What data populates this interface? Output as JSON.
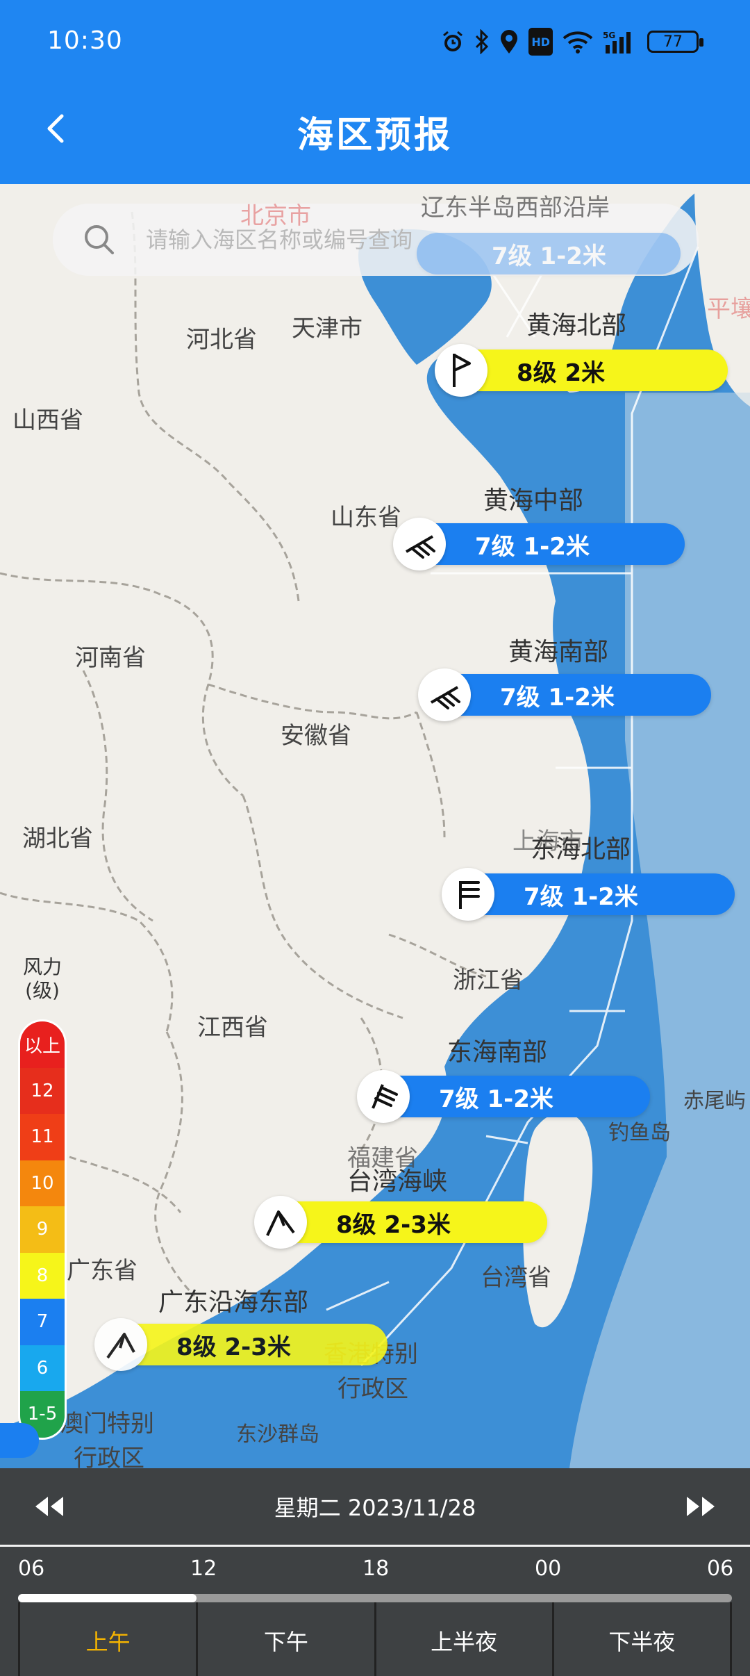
{
  "status_bar": {
    "time": "10:30",
    "battery": "77",
    "network": "5G",
    "hd": "HD"
  },
  "header": {
    "title": "海区预报"
  },
  "search": {
    "placeholder": "请输入海区名称或编号查询"
  },
  "map": {
    "places": {
      "beijing": "北京市",
      "liaodong_top": "辽东半岛西部沿岸",
      "tianjin": "天津市",
      "hebei": "河北省",
      "pingrang": "平壤",
      "shanxi": "山西省",
      "shandong": "山东省",
      "henan": "河南省",
      "anhui": "安徽省",
      "hubei": "湖北省",
      "shanghai": "上海市",
      "zhejiang": "浙江省",
      "jiangxi": "江西省",
      "chiwei": "赤尾屿",
      "diaoyu": "钓鱼岛",
      "fujian": "福建省",
      "taiwan": "台湾省",
      "guangdong": "广东省",
      "hongkong_1": "香港特别",
      "hongkong_2": "行政区",
      "macao_1": "澳门特别",
      "macao_2": "行政区",
      "dongsha": "东沙群岛"
    },
    "sea_areas": [
      {
        "name": "辽东半岛西部沿岸",
        "forecast": "7级  1-2米",
        "level": "7"
      },
      {
        "name": "黄海北部",
        "forecast": "8级  2米",
        "level": "8"
      },
      {
        "name": "黄海中部",
        "forecast": "7级  1-2米",
        "level": "7"
      },
      {
        "name": "黄海南部",
        "forecast": "7级  1-2米",
        "level": "7"
      },
      {
        "name": "东海北部",
        "forecast": "7级  1-2米",
        "level": "7"
      },
      {
        "name": "东海南部",
        "forecast": "7级  1-2米",
        "level": "7"
      },
      {
        "name": "台湾海峡",
        "forecast": "8级  2-3米",
        "level": "8"
      },
      {
        "name": "广东沿海东部",
        "forecast": "8级  2-3米",
        "level": "8"
      }
    ]
  },
  "legend": {
    "title_line1": "风力",
    "title_line2": "(级)",
    "levels": [
      {
        "label": "以上",
        "color": "#e8201e"
      },
      {
        "label": "12",
        "color": "#e62e1c"
      },
      {
        "label": "11",
        "color": "#ef3e17"
      },
      {
        "label": "10",
        "color": "#f4870d"
      },
      {
        "label": "9",
        "color": "#f4bd16"
      },
      {
        "label": "8",
        "color": "#f6f51a"
      },
      {
        "label": "7",
        "color": "#1b7ff0"
      },
      {
        "label": "6",
        "color": "#18a8ee"
      },
      {
        "label": "1-5",
        "color": "#20a34a"
      }
    ]
  },
  "date_bar": {
    "date": "星期二 2023/11/28"
  },
  "timeline": {
    "hours": [
      "06",
      "12",
      "18",
      "00",
      "06"
    ],
    "progress": 0.25,
    "segments": [
      {
        "label": "上午",
        "active": true
      },
      {
        "label": "下午",
        "active": false
      },
      {
        "label": "上半夜",
        "active": false
      },
      {
        "label": "下半夜",
        "active": false
      }
    ]
  },
  "colors": {
    "header": "#1f86f2",
    "accent_active": "#f5b400",
    "bar": "#3e4143",
    "sea": "#3d8fd6"
  }
}
